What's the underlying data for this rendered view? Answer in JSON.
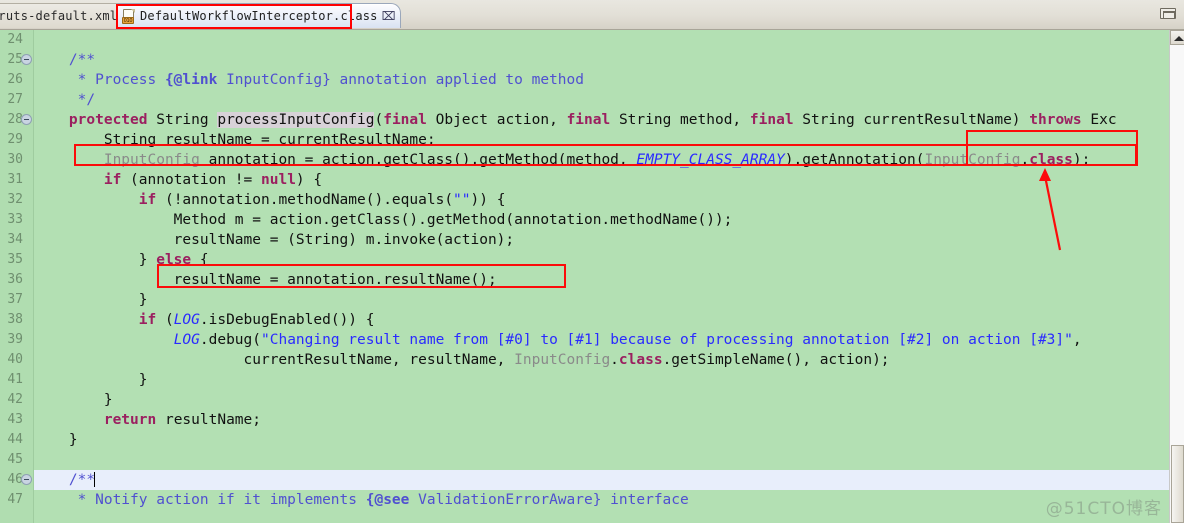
{
  "window": {
    "minimize_button_label": "",
    "watermark": "@51CTO博客"
  },
  "tabs": [
    {
      "label": "truts-default.xml",
      "active": false,
      "icon": "xml-file-icon"
    },
    {
      "label": "DefaultWorkflowInterceptor.class",
      "active": true,
      "icon": "class-file-icon",
      "close_label": "⌧",
      "icon_bits": "010"
    }
  ],
  "editor": {
    "language": "java",
    "gutter_start_line": "24",
    "line_numbers": [
      "24",
      "25",
      "26",
      "27",
      "28",
      "29",
      "30",
      "31",
      "32",
      "33",
      "34",
      "35",
      "36",
      "37",
      "38",
      "39",
      "40",
      "41",
      "42",
      "43",
      "44",
      "45",
      "46",
      "47"
    ],
    "fold_markers_on": [
      "25",
      "28",
      "46"
    ],
    "highlighted_line": "46",
    "lines": [
      {
        "n": "24",
        "text": ""
      },
      {
        "n": "25",
        "text": "    /**"
      },
      {
        "n": "26",
        "text": "     * Process {@link InputConfig} annotation applied to method"
      },
      {
        "n": "27",
        "text": "     */"
      },
      {
        "n": "28",
        "text": "    protected String processInputConfig(final Object action, final String method, final String currentResultName) throws Exc"
      },
      {
        "n": "29",
        "text": "        String resultName = currentResultName;"
      },
      {
        "n": "30",
        "text": "        InputConfig annotation = action.getClass().getMethod(method, EMPTY_CLASS_ARRAY).getAnnotation(InputConfig.class);"
      },
      {
        "n": "31",
        "text": "        if (annotation != null) {"
      },
      {
        "n": "32",
        "text": "            if (!annotation.methodName().equals(\"\")) {"
      },
      {
        "n": "33",
        "text": "                Method m = action.getClass().getMethod(annotation.methodName());"
      },
      {
        "n": "34",
        "text": "                resultName = (String) m.invoke(action);"
      },
      {
        "n": "35",
        "text": "            } else {"
      },
      {
        "n": "36",
        "text": "                resultName = annotation.resultName();"
      },
      {
        "n": "37",
        "text": "            }"
      },
      {
        "n": "38",
        "text": "            if (LOG.isDebugEnabled()) {"
      },
      {
        "n": "39",
        "text": "                LOG.debug(\"Changing result name from [#0] to [#1] because of processing annotation [#2] on action [#3]\","
      },
      {
        "n": "40",
        "text": "                        currentResultName, resultName, InputConfig.class.getSimpleName(), action);"
      },
      {
        "n": "41",
        "text": "            }"
      },
      {
        "n": "42",
        "text": "        }"
      },
      {
        "n": "43",
        "text": "        return resultName;"
      },
      {
        "n": "44",
        "text": "    }"
      },
      {
        "n": "45",
        "text": ""
      },
      {
        "n": "46",
        "text": "    /**"
      },
      {
        "n": "47",
        "text": "     * Notify action if it implements {@see ValidationErrorAware} interface"
      }
    ]
  },
  "annotations": {
    "boxes": [
      {
        "name": "tab-highlight",
        "target": "DefaultWorkflowInterceptor.class tab"
      },
      {
        "name": "line-30-highlight",
        "target": "InputConfig annotation = action.getClass().getMethod(method, EMPTY_CLASS_ARRAY).getAnnotation(InputConfig.class);"
      },
      {
        "name": "inputconfig-class-highlight",
        "target": "InputConfig.class"
      },
      {
        "name": "line-36-highlight",
        "target": "resultName = annotation.resultName();"
      }
    ],
    "arrow": {
      "name": "callout-arrow",
      "points_to": "InputConfig.class",
      "color": "#fc0b0b"
    }
  },
  "colors": {
    "editor_background": "#b3e0b3",
    "gutter_background": "#b0ddb0",
    "current_line": "#e8eefb",
    "keyword": "#9b2060",
    "string": "#2a2aff",
    "comment": "#5050d0",
    "static_field": "#2a2aff",
    "annotation_red": "#fc0b0b",
    "tab_active": "#e8eefb"
  },
  "scrollbar": {
    "orientation": "vertical",
    "up_arrow": "▲",
    "thumb_position_pct": 80
  }
}
